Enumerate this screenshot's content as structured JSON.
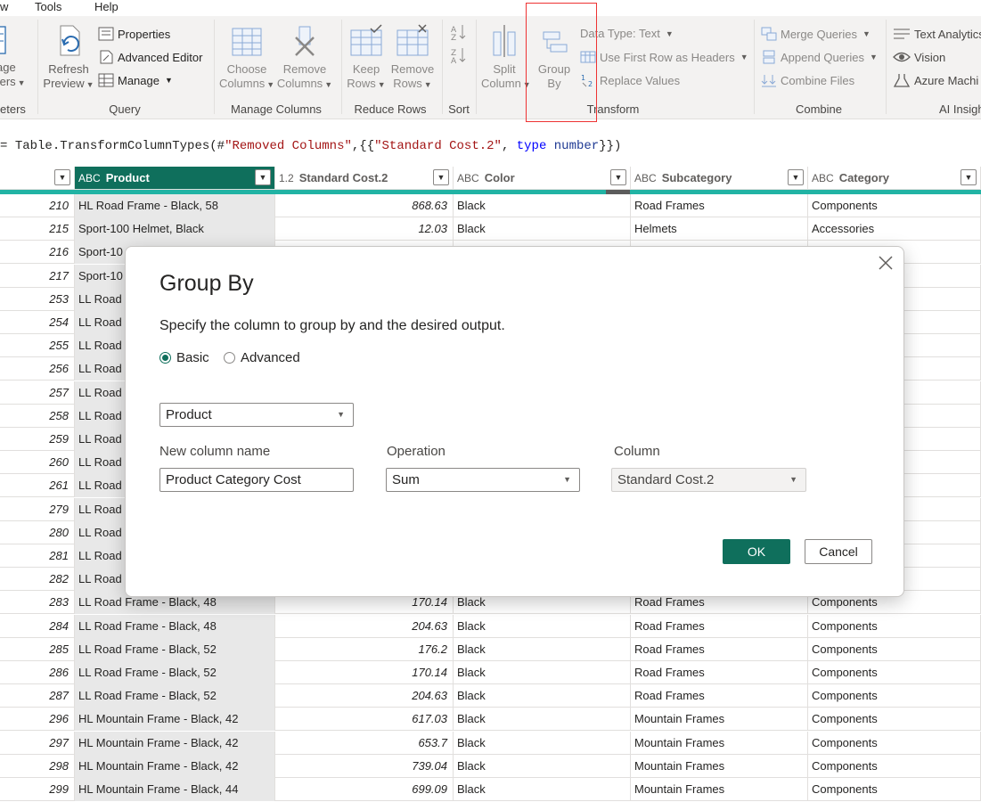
{
  "menu": {
    "items": [
      "w",
      "Tools",
      "Help"
    ]
  },
  "ribbon": {
    "params_partial": {
      "line1": "age",
      "line2": "ters",
      "group": "eters"
    },
    "refresh_preview": {
      "line1": "Refresh",
      "line2": "Preview"
    },
    "properties": "Properties",
    "advanced_editor": "Advanced Editor",
    "manage": "Manage",
    "group_query": "Query",
    "choose_columns": {
      "line1": "Choose",
      "line2": "Columns"
    },
    "remove_columns": {
      "line1": "Remove",
      "line2": "Columns"
    },
    "group_manage_columns": "Manage Columns",
    "keep_rows": {
      "line1": "Keep",
      "line2": "Rows"
    },
    "remove_rows": {
      "line1": "Remove",
      "line2": "Rows"
    },
    "group_reduce_rows": "Reduce Rows",
    "group_sort": "Sort",
    "split_column": {
      "line1": "Split",
      "line2": "Column"
    },
    "group_by": {
      "line1": "Group",
      "line2": "By"
    },
    "data_type": "Data Type: Text",
    "use_first_row": "Use First Row as Headers",
    "replace_values": "Replace Values",
    "group_transform": "Transform",
    "merge_queries": "Merge Queries",
    "append_queries": "Append Queries",
    "combine_files": "Combine Files",
    "group_combine": "Combine",
    "text_analytics": "Text Analytics",
    "vision": "Vision",
    "azure_ml": "Azure Machi",
    "group_ai": "AI Insigh"
  },
  "formula": {
    "prefix": "= ",
    "fn": "Table.TransformColumnTypes(#",
    "arg_str": "\"Removed Columns\"",
    "mid": ",{{",
    "col_str": "\"Standard Cost.2\"",
    "sep": ", ",
    "kw": "type",
    "type_name": "number",
    "end": "}})"
  },
  "grid": {
    "headers": [
      {
        "type": "",
        "label": ""
      },
      {
        "type": "ABC",
        "label": "Product"
      },
      {
        "type": "1.2",
        "label": "Standard Cost.2"
      },
      {
        "type": "ABC",
        "label": "Color"
      },
      {
        "type": "ABC",
        "label": "Subcategory"
      },
      {
        "type": "ABC",
        "label": "Category"
      }
    ],
    "rows": [
      [
        "210",
        "HL Road Frame - Black, 58",
        "868.63",
        "Black",
        "Road Frames",
        "Components"
      ],
      [
        "215",
        "Sport-100 Helmet, Black",
        "12.03",
        "Black",
        "Helmets",
        "Accessories"
      ],
      [
        "216",
        "Sport-10",
        "",
        "",
        "",
        ""
      ],
      [
        "217",
        "Sport-10",
        "",
        "",
        "",
        ""
      ],
      [
        "253",
        "LL Road",
        "",
        "",
        "",
        ""
      ],
      [
        "254",
        "LL Road",
        "",
        "",
        "",
        ""
      ],
      [
        "255",
        "LL Road",
        "",
        "",
        "",
        ""
      ],
      [
        "256",
        "LL Road",
        "",
        "",
        "",
        ""
      ],
      [
        "257",
        "LL Road",
        "",
        "",
        "",
        ""
      ],
      [
        "258",
        "LL Road",
        "",
        "",
        "",
        ""
      ],
      [
        "259",
        "LL Road",
        "",
        "",
        "",
        ""
      ],
      [
        "260",
        "LL Road",
        "",
        "",
        "",
        ""
      ],
      [
        "261",
        "LL Road",
        "",
        "",
        "",
        ""
      ],
      [
        "279",
        "LL Road",
        "",
        "",
        "",
        ""
      ],
      [
        "280",
        "LL Road",
        "",
        "",
        "",
        ""
      ],
      [
        "281",
        "LL Road",
        "",
        "",
        "",
        ""
      ],
      [
        "282",
        "LL Road",
        "",
        "",
        "",
        ""
      ],
      [
        "283",
        "LL Road Frame - Black, 48",
        "170.14",
        "Black",
        "Road Frames",
        "Components"
      ],
      [
        "284",
        "LL Road Frame - Black, 48",
        "204.63",
        "Black",
        "Road Frames",
        "Components"
      ],
      [
        "285",
        "LL Road Frame - Black, 52",
        "176.2",
        "Black",
        "Road Frames",
        "Components"
      ],
      [
        "286",
        "LL Road Frame - Black, 52",
        "170.14",
        "Black",
        "Road Frames",
        "Components"
      ],
      [
        "287",
        "LL Road Frame - Black, 52",
        "204.63",
        "Black",
        "Road Frames",
        "Components"
      ],
      [
        "296",
        "HL Mountain Frame - Black, 42",
        "617.03",
        "Black",
        "Mountain Frames",
        "Components"
      ],
      [
        "297",
        "HL Mountain Frame - Black, 42",
        "653.7",
        "Black",
        "Mountain Frames",
        "Components"
      ],
      [
        "298",
        "HL Mountain Frame - Black, 42",
        "739.04",
        "Black",
        "Mountain Frames",
        "Components"
      ],
      [
        "299",
        "HL Mountain Frame - Black, 44",
        "699.09",
        "Black",
        "Mountain Frames",
        "Components"
      ]
    ]
  },
  "dialog": {
    "title": "Group By",
    "description": "Specify the column to group by and the desired output.",
    "radio_basic": "Basic",
    "radio_advanced": "Advanced",
    "selected_mode": "Basic",
    "group_column_value": "Product",
    "new_column_label": "New column name",
    "new_column_value": "Product Category Cost",
    "operation_label": "Operation",
    "operation_value": "Sum",
    "column_label": "Column",
    "column_value": "Standard Cost.2",
    "ok_label": "OK",
    "cancel_label": "Cancel"
  },
  "colors": {
    "accent": "#0f6f5c",
    "teal_bar": "#21b3a4",
    "highlight": "#e33333"
  }
}
